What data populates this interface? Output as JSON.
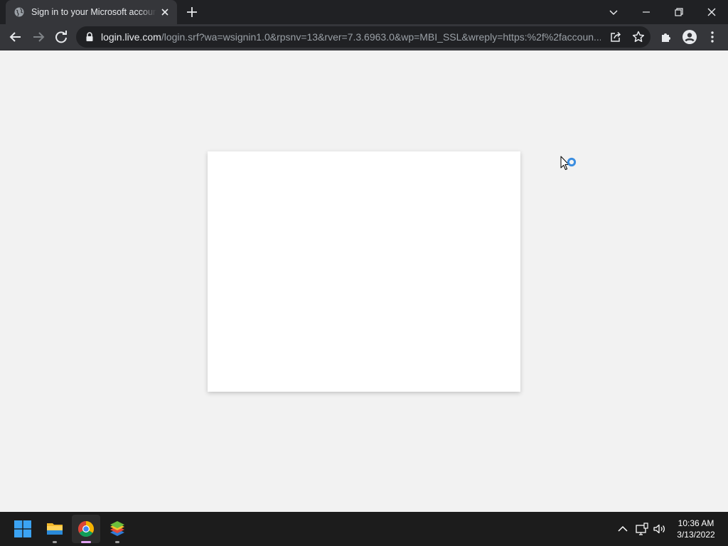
{
  "browser": {
    "tab": {
      "title": "Sign in to your Microsoft account"
    },
    "address_bar": {
      "host": "login.live.com",
      "path": "/login.srf?wa=wsignin1.0&rpsnv=13&rver=7.3.6963.0&wp=MBI_SSL&wreply=https:%2f%2faccoun..."
    }
  },
  "colors": {
    "chrome_dark": "#202124",
    "chrome_toolbar": "#35363a",
    "page_background": "#f2f2f2",
    "card_background": "#ffffff",
    "loading_accent": "#3c8ee0",
    "taskbar": "#1c1c1c"
  },
  "taskbar": {
    "apps": [
      "start-icon",
      "file-explorer-icon",
      "chrome-icon",
      "bluestacks-icon"
    ],
    "active_app": "chrome-icon",
    "clock": {
      "time": "10:36 AM",
      "date": "3/13/2022"
    }
  }
}
